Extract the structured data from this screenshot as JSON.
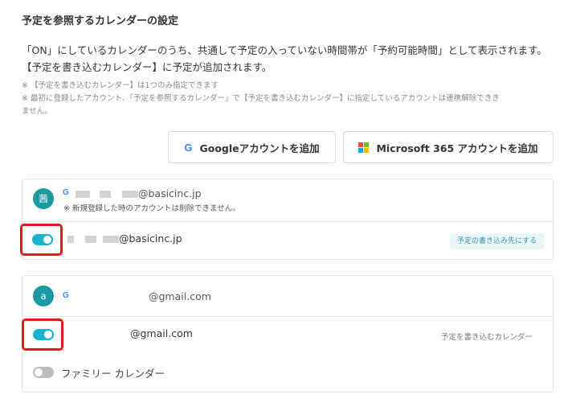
{
  "section": {
    "title": "予定を参照するカレンダーの設定",
    "desc_line1": "「ON」にしているカレンダーのうち、共通して予定の入っていない時間帯が「予約可能時間」として表示されます。",
    "desc_line2": "【予定を書き込むカレンダー】に予定が追加されます。",
    "note1": "※ 【予定を書き込むカレンダー】は1つのみ指定できます",
    "note2": "※ 最初に登録したアカウント、「予定を参照するカレンダー」で【予定を書き込むカレンダー】に指定しているアカウントは連携解除できき",
    "note3": "ません。"
  },
  "buttons": {
    "google_label": "Googleアカウントを追加",
    "microsoft_label": "Microsoft 365 アカウントを追加"
  },
  "accounts": [
    {
      "avatar": "茜",
      "email": "@basicinc.jp",
      "note": "※ 新規登録した時のアカウントは削除できません。",
      "calendars": [
        {
          "name": "@basicinc.jp",
          "enabled": true,
          "action": "予定の書き込み先にする"
        }
      ]
    },
    {
      "avatar": "a",
      "email": "@gmail.com",
      "calendars": [
        {
          "name": "@gmail.com",
          "enabled": true,
          "label": "予定を書き込むカレンダー"
        },
        {
          "name": "ファミリー カレンダー",
          "enabled": false
        }
      ]
    }
  ],
  "icons": {
    "google": "google-g-icon",
    "microsoft": "microsoft-logo-icon"
  },
  "colors": {
    "accent": "#16b4cc",
    "avatar": "#1a9aa3",
    "highlight": "#e21b1b"
  }
}
